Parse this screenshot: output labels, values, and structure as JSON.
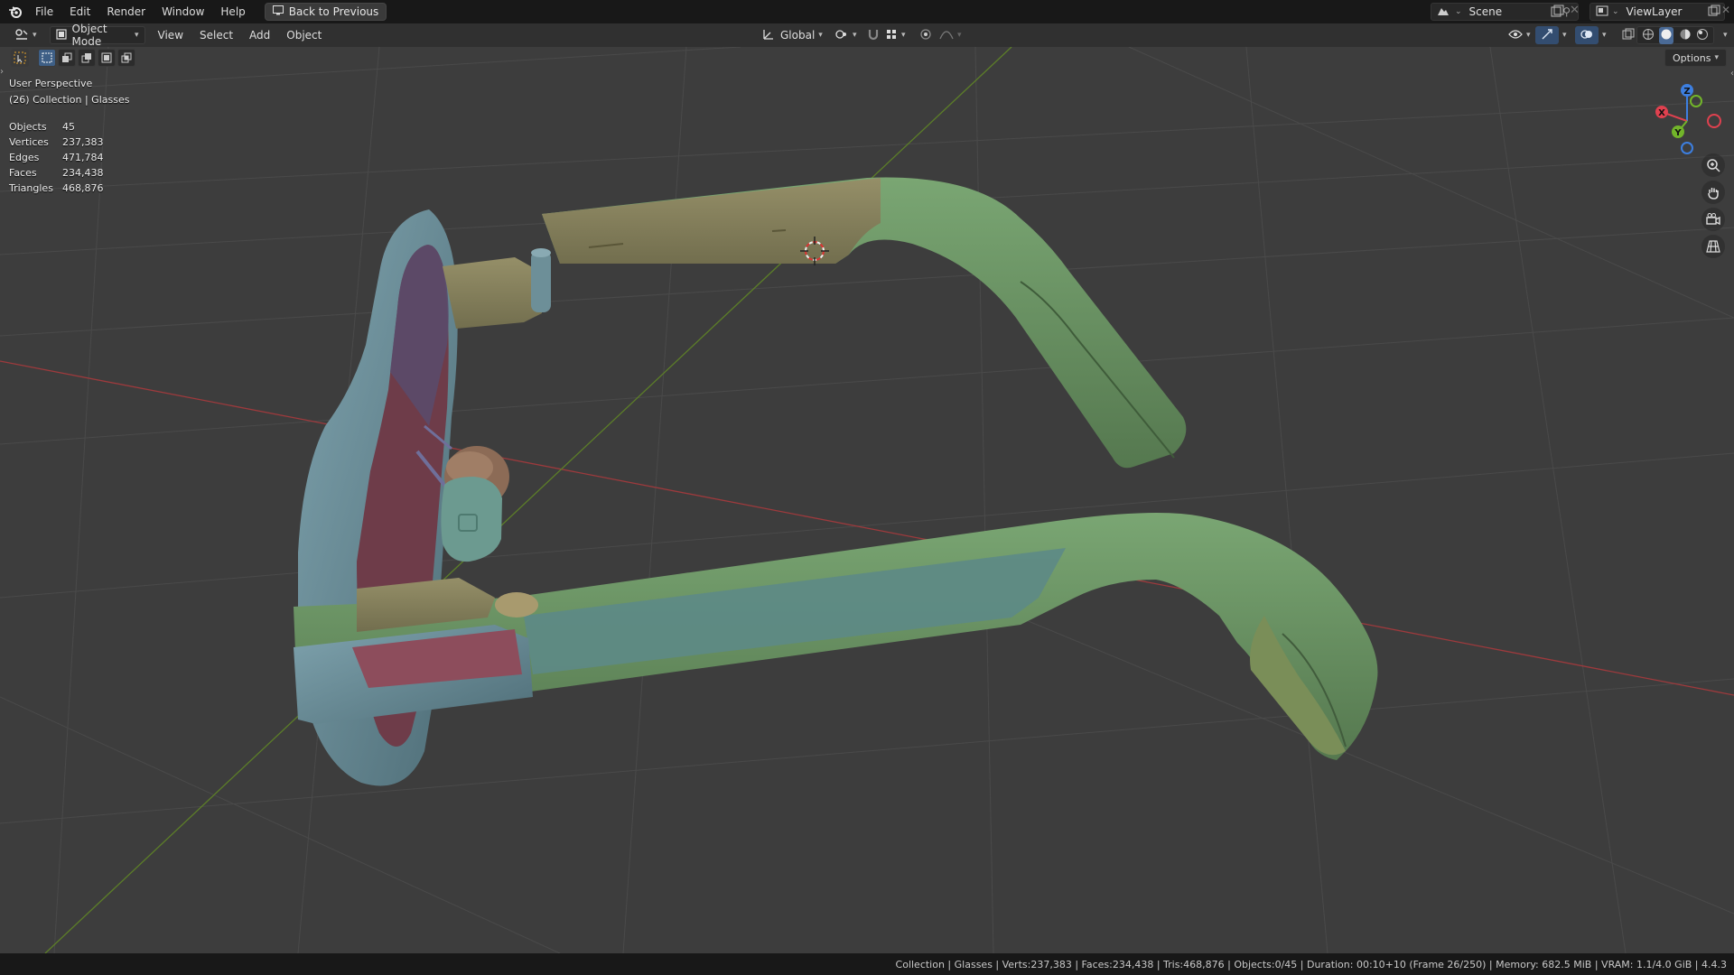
{
  "menu": {
    "items": [
      "File",
      "Edit",
      "Render",
      "Window",
      "Help"
    ],
    "back_button": "Back to Previous"
  },
  "workspace": {
    "scene": "Scene",
    "view_layer": "ViewLayer"
  },
  "viewport_header": {
    "mode": "Object Mode",
    "menus": [
      "View",
      "Select",
      "Add",
      "Object"
    ],
    "transform_orientation": "Global",
    "options_label": "Options"
  },
  "overlay": {
    "perspective": "User Perspective",
    "collection": "(26) Collection | Glasses"
  },
  "stats": [
    {
      "label": "Objects",
      "value": "45"
    },
    {
      "label": "Vertices",
      "value": "237,383"
    },
    {
      "label": "Edges",
      "value": "471,784"
    },
    {
      "label": "Faces",
      "value": "234,438"
    },
    {
      "label": "Triangles",
      "value": "468,876"
    }
  ],
  "gizmo": {
    "x": "X",
    "y": "Y",
    "z": "Z",
    "x_color": "#e0414f",
    "y_color": "#72b52a",
    "z_color": "#3d7fe0"
  },
  "statusbar": {
    "text": "Collection | Glasses | Verts:237,383 | Faces:234,438 | Tris:468,876 | Objects:0/45 | Duration: 00:10+10 (Frame 26/250) | Memory: 682.5 MiB | VRAM: 1.1/4.0 GiB | 4.4.3"
  },
  "colors": {
    "frame_blue": "#6b8f9a",
    "arm_green": "#6f9a66",
    "arm_yellow": "#8a8660",
    "lens_red": "#7c4147",
    "pad_brown": "#8a6a55"
  }
}
